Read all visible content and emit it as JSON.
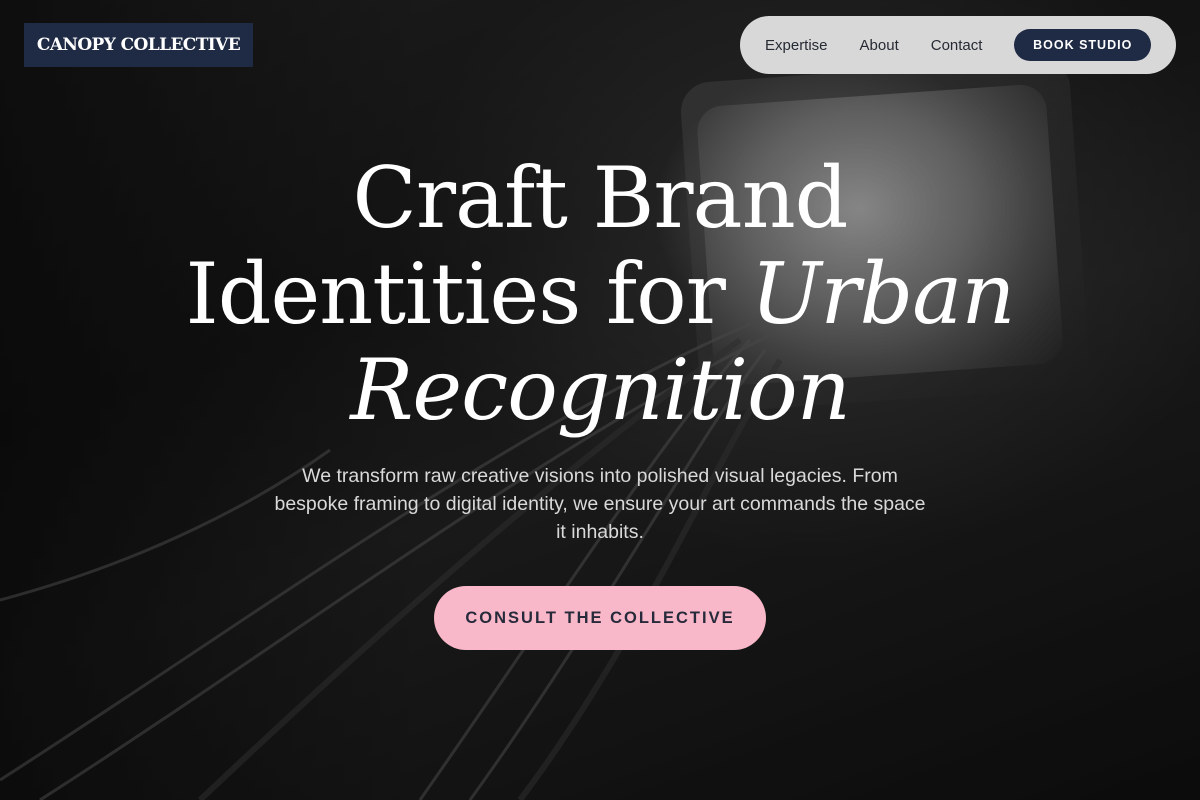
{
  "header": {
    "logo_text": "CANOPY COLLECTIVE"
  },
  "nav": {
    "links": [
      {
        "label": "Expertise"
      },
      {
        "label": "About"
      },
      {
        "label": "Contact"
      }
    ],
    "book_button": "BOOK STUDIO"
  },
  "hero": {
    "headline_line1": "Craft Brand",
    "headline_line2_plain": "Identities for ",
    "headline_line2_italic": "Urban",
    "headline_line3_italic": "Recognition",
    "subtitle": "We transform raw creative visions into polished visual legacies. From bespoke framing to digital identity, we ensure your art commands the space it inhabits.",
    "cta_label": "CONSULT THE COLLECTIVE"
  },
  "colors": {
    "brand_navy": "#1f2a44",
    "accent_pink": "#f9b8c9",
    "nav_pill": "#d8d8d8"
  }
}
